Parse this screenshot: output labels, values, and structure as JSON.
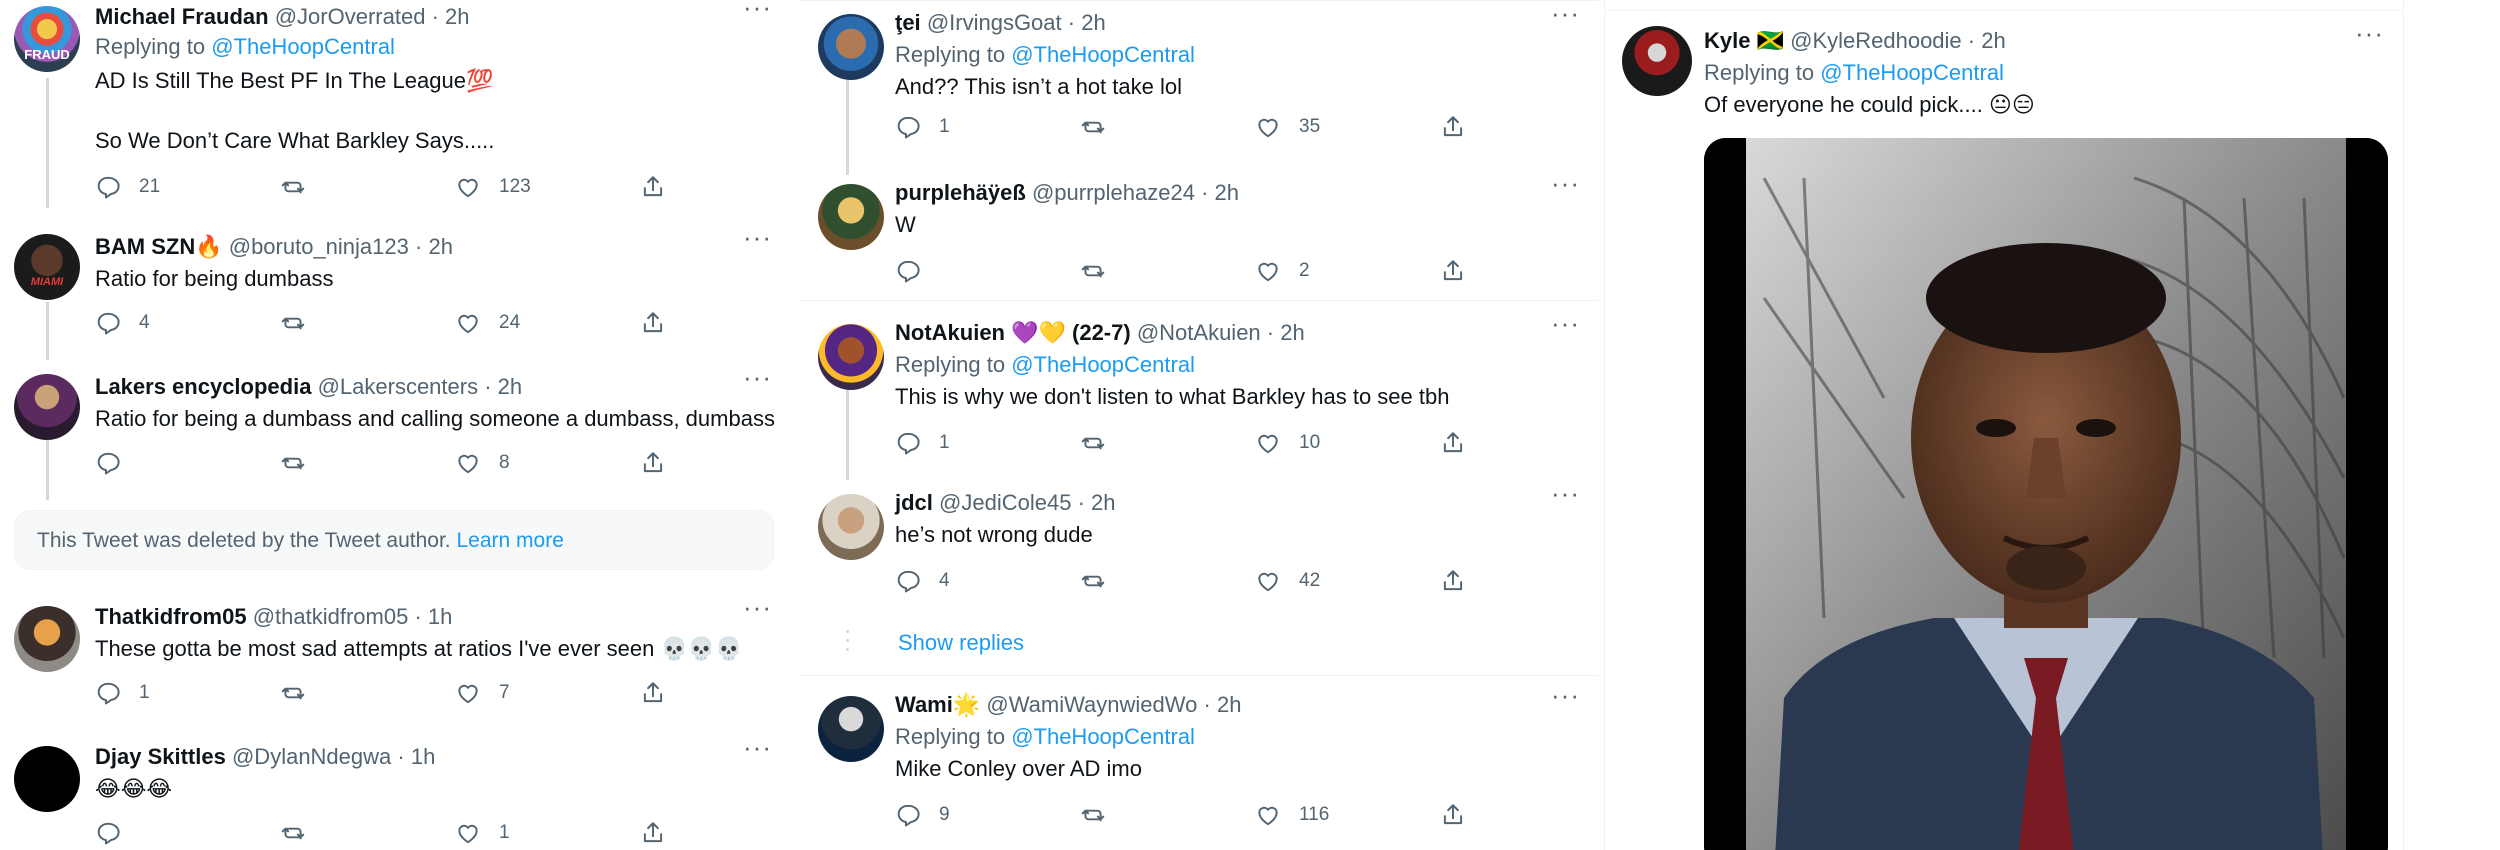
{
  "col1": {
    "tweets": [
      {
        "name": "Michael Fraudan",
        "handle": "@JorOverrated",
        "time": "2h",
        "replying_to": "@TheHoopCentral",
        "text": "AD Is Still The Best PF In The League💯\n\nSo We Don’t Care What Barkley Says.....",
        "replies": "21",
        "likes": "123",
        "avatar_label": "FRAUD"
      },
      {
        "name": "BAM SZN🔥",
        "handle": "@boruto_ninja123",
        "time": "2h",
        "text": "Ratio for being dumbass",
        "replies": "4",
        "likes": "24",
        "avatar_label": "MIAMI"
      },
      {
        "name": "Lakers encyclopedia",
        "handle": "@Lakerscenters",
        "time": "2h",
        "text": "Ratio for being a dumbass and calling someone a dumbass, dumbass",
        "replies": "",
        "likes": "8"
      },
      {
        "name": "Thatkidfrom05",
        "handle": "@thatkidfrom05",
        "time": "1h",
        "text": "These gotta be most sad attempts at ratios I've ever seen 💀💀💀",
        "replies": "1",
        "likes": "7"
      },
      {
        "name": "Djay Skittles",
        "handle": "@DylanNdegwa",
        "time": "1h",
        "text": "😂😂😂",
        "replies": "",
        "likes": "1"
      }
    ],
    "deleted": {
      "text": "This Tweet was deleted by the Tweet author.",
      "link": "Learn more"
    }
  },
  "col2": {
    "tweets": [
      {
        "name": "ţei",
        "handle": "@IrvingsGoat",
        "time": "2h",
        "replying_to": "@TheHoopCentral",
        "text": "And?? This isn’t a hot take lol",
        "replies": "1",
        "likes": "35"
      },
      {
        "name": "purplehäÿeß",
        "handle": "@purrplehaze24",
        "time": "2h",
        "text": "W",
        "replies": "",
        "likes": "2"
      },
      {
        "name": "NotAkuien 💜💛 (22-7)",
        "handle": "@NotAkuien",
        "time": "2h",
        "replying_to": "@TheHoopCentral",
        "text": "This is why we don't listen to what Barkley has to see tbh",
        "replies": "1",
        "likes": "10"
      },
      {
        "name": "jdcl",
        "handle": "@JediCole45",
        "time": "2h",
        "text": "he’s not wrong dude",
        "replies": "4",
        "likes": "42"
      },
      {
        "name": "Wami🌟",
        "handle": "@WamiWaynwiedWo",
        "time": "2h",
        "replying_to": "@TheHoopCentral",
        "text": "Mike Conley over AD imo",
        "replies": "9",
        "likes": "116"
      }
    ],
    "show_replies": "Show replies"
  },
  "col3": {
    "tweet": {
      "name": "Kyle 🇯🇲",
      "handle": "@KyleRedhoodie",
      "time": "2h",
      "replying_to": "@TheHoopCentral",
      "text": "Of everyone he could pick.... 😐😑"
    }
  },
  "ui": {
    "replying_prefix": "Replying to ",
    "dot": "·",
    "more": "···"
  },
  "colors": {
    "accent": "#1d9bf0",
    "text": "#0f1419",
    "muted": "#536471",
    "border": "#eff3f4",
    "thread": "#cfd9de"
  },
  "icons": [
    "reply-icon",
    "retweet-icon",
    "like-icon",
    "share-icon",
    "more-icon"
  ]
}
